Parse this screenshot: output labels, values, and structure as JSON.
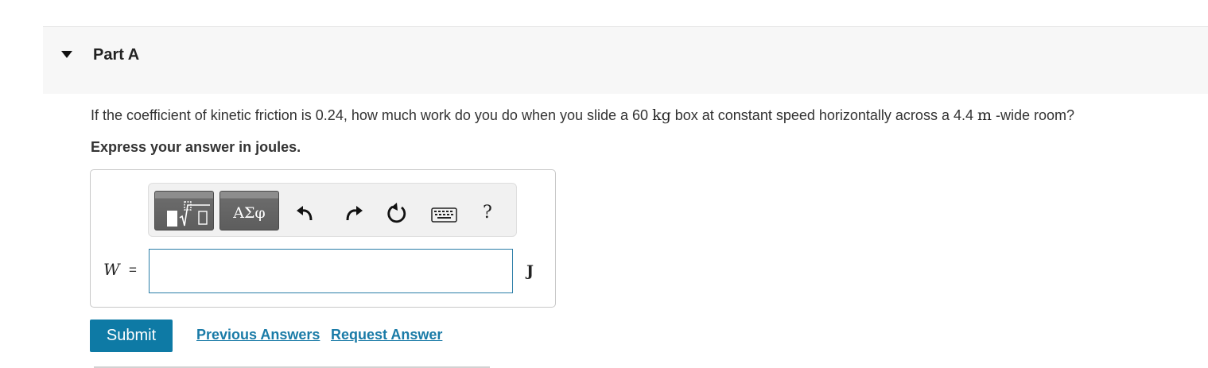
{
  "part": {
    "title": "Part A"
  },
  "question": {
    "text_1": "If the coefficient of kinetic friction is 0.24, how much work do you do when you slide a 60 ",
    "unit_1": "kg",
    "text_2": " box at constant speed horizontally across a 4.4 ",
    "unit_2": "m",
    "text_3": " -wide room?",
    "instruction": "Express your answer in joules."
  },
  "toolbar": {
    "greek_label": "ΑΣφ",
    "help_label": "?",
    "icons": [
      "templates-icon",
      "greek-letters-icon",
      "undo-icon",
      "redo-icon",
      "reset-icon",
      "keyboard-icon",
      "help-icon"
    ]
  },
  "answer": {
    "variable": "W",
    "equals": "=",
    "value": "",
    "unit": "J"
  },
  "actions": {
    "submit_label": "Submit",
    "previous_answers_label": "Previous Answers",
    "request_answer_label": "Request Answer"
  },
  "colors": {
    "accent": "#0e7aa5",
    "link": "#1a7ba7",
    "input_border": "#2a7da7",
    "header_bg": "#f7f7f7"
  }
}
